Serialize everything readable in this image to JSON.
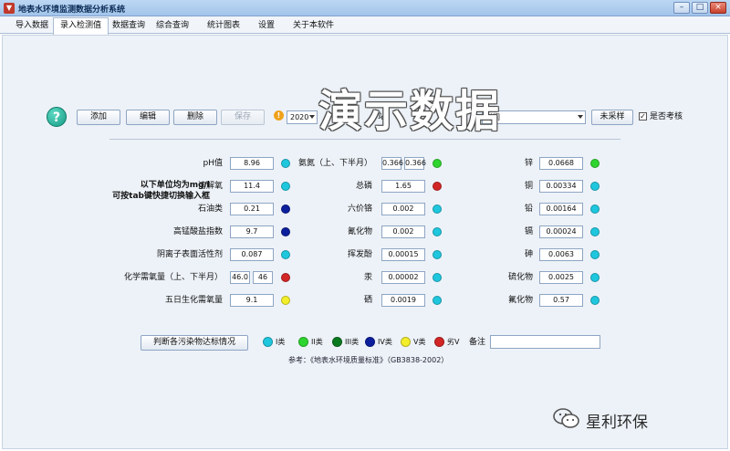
{
  "window": {
    "title": "地表水环境监测数据分析系统",
    "buttons": [
      "–",
      "□",
      "×"
    ]
  },
  "tabs": [
    "导入数据",
    "录入检测值",
    "数据查询",
    "综合查询",
    "统计图表",
    "设置",
    "关于本软件"
  ],
  "toolbar": {
    "help_label": "?",
    "add": "添加",
    "edit": "编辑",
    "delete": "删除",
    "save": "保存",
    "warn_label": "!",
    "year": "2020",
    "station_label": "站",
    "period_label": "时间",
    "sample": "未采样",
    "check_label": "是否考核",
    "check_mark": "✓"
  },
  "note": "以下单位均为mg/l\n可按tab键快捷切换输入框",
  "params_left": [
    {
      "label": "pH值",
      "value": "8.96",
      "color": "#1fc7de"
    },
    {
      "label": "溶解氧",
      "value": "11.4",
      "color": "#1fc7de"
    },
    {
      "label": "石油类",
      "value": "0.21",
      "color": "#0c1f9c"
    },
    {
      "label": "高锰酸盐指数",
      "value": "9.7",
      "color": "#0c1f9c"
    },
    {
      "label": "阴离子表面活性剂",
      "value": "0.087",
      "color": "#1fc7de"
    },
    {
      "label": "化学需氧量（上、下半月）",
      "value": "46.0",
      "value2": "46",
      "color": "#d22626"
    },
    {
      "label": "五日生化需氧量",
      "value": "9.1",
      "color": "#f3ee2a"
    }
  ],
  "params_mid": [
    {
      "label": "氨氮（上、下半月）",
      "value": "0.366",
      "value2": "0.366",
      "color": "#2fd52f"
    },
    {
      "label": "总磷",
      "value": "1.65",
      "color": "#d22626"
    },
    {
      "label": "六价铬",
      "value": "0.002",
      "color": "#1fc7de"
    },
    {
      "label": "氰化物",
      "value": "0.002",
      "color": "#1fc7de"
    },
    {
      "label": "挥发酚",
      "value": "0.00015",
      "color": "#1fc7de"
    },
    {
      "label": "汞",
      "value": "0.00002",
      "color": "#1fc7de"
    },
    {
      "label": "硒",
      "value": "0.0019",
      "color": "#1fc7de"
    }
  ],
  "params_right": [
    {
      "label": "锌",
      "value": "0.0668",
      "color": "#2fd52f"
    },
    {
      "label": "铜",
      "value": "0.00334",
      "color": "#1fc7de"
    },
    {
      "label": "铅",
      "value": "0.00164",
      "color": "#1fc7de"
    },
    {
      "label": "镉",
      "value": "0.00024",
      "color": "#1fc7de"
    },
    {
      "label": "砷",
      "value": "0.0063",
      "color": "#1fc7de"
    },
    {
      "label": "硫化物",
      "value": "0.0025",
      "color": "#1fc7de"
    },
    {
      "label": "氟化物",
      "value": "0.57",
      "color": "#1fc7de"
    }
  ],
  "judge_button": "判断各污染物达标情况",
  "legend": [
    {
      "label": "I类",
      "color": "#1fc7de"
    },
    {
      "label": "II类",
      "color": "#2fd52f"
    },
    {
      "label": "III类",
      "color": "#0a7a1f"
    },
    {
      "label": "IV类",
      "color": "#0c1f9c"
    },
    {
      "label": "V类",
      "color": "#f3ee2a"
    },
    {
      "label": "劣V",
      "color": "#d22626"
    }
  ],
  "remark_label": "备注",
  "reference": "参考：《地表水环境质量标准》（GB3838-2002）",
  "watermark": "演示数据",
  "wechat_account": "星利环保"
}
